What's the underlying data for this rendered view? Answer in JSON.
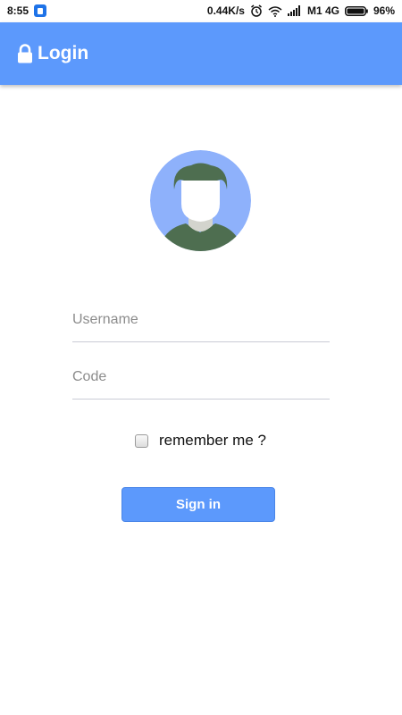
{
  "status_bar": {
    "time": "8:55",
    "network_speed": "0.44K/s",
    "carrier": "M1 4G",
    "battery": "96%",
    "icons": [
      "app-notification-icon",
      "alarm-icon",
      "wifi-icon",
      "signal-icon",
      "battery-icon"
    ]
  },
  "app_bar": {
    "title": "Login",
    "icon": "lock-icon",
    "color": "#5c99fc"
  },
  "avatar": {
    "icon": "user-avatar-icon",
    "colors": {
      "background": "#8eb1fb",
      "hair": "#4e6e50",
      "shirt": "#4e6e50"
    }
  },
  "form": {
    "username_placeholder": "Username",
    "username_value": "",
    "code_placeholder": "Code",
    "code_value": "",
    "remember_label": "remember me ?",
    "remember_checked": false,
    "signin_label": "Sign in"
  }
}
